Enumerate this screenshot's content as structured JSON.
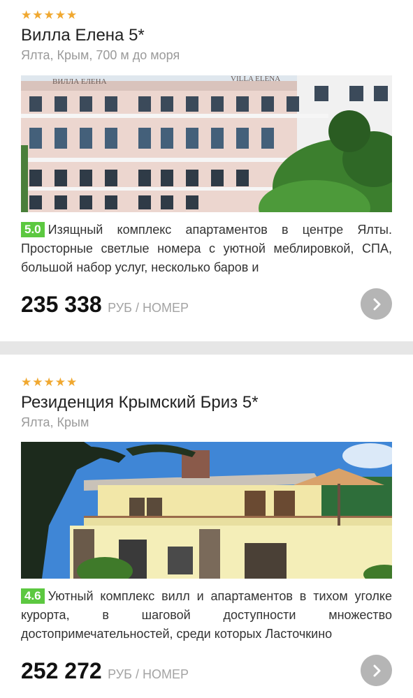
{
  "colors": {
    "star": "#f0a830",
    "rating_badge": "#5cc840",
    "divider": "#e6e6e6",
    "arrow_button": "#b5b5b5",
    "top_accent": "#2d6f8f"
  },
  "hotels": [
    {
      "stars": "★★★★★",
      "star_count": 5,
      "name": "Вилла Елена 5*",
      "location": "Ялта, Крым, 700 м до моря",
      "photo_sign_left": "ВИЛЛА ЕЛЕНА",
      "photo_sign_right": "VILLA ELENA",
      "rating": "5.0",
      "description": "Изящный комплекс апартаментов в центре Ялты. Просторные светлые номера с уютной меблировкой, СПА, большой набор услуг, несколько баров и",
      "price": "235 338",
      "price_unit": "РУБ / НОМЕР",
      "next_icon": "chevron-right-icon"
    },
    {
      "stars": "★★★★★",
      "star_count": 5,
      "name": "Резиденция Крымский Бриз 5*",
      "location": "Ялта, Крым",
      "rating": "4.6",
      "description": "Уютный комплекс вилл и апартаментов в тихом уголке курорта, в шаговой доступности множество достопримечательностей, среди которых Ласточкино",
      "price": "252 272",
      "price_unit": "РУБ / НОМЕР",
      "next_icon": "chevron-right-icon"
    }
  ]
}
